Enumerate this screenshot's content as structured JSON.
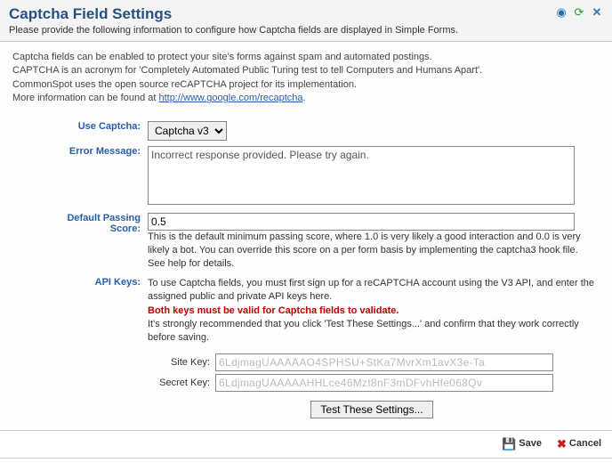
{
  "header": {
    "title": "Captcha Field Settings",
    "subtitle": "Please provide the following information to configure how Captcha fields are displayed in Simple Forms."
  },
  "intro": {
    "line1": "Captcha fields can be enabled to protect your site's forms against spam and automated postings.",
    "line2": "CAPTCHA is an acronym for 'Completely Automated Public Turing test to tell Computers and Humans Apart'.",
    "line3": "CommonSpot uses the open source reCAPTCHA project for its implementation.",
    "line4_prefix": "More information can be found at ",
    "link": "http://www.google.com/recaptcha",
    "line4_suffix": "."
  },
  "labels": {
    "use_captcha": "Use Captcha:",
    "error_message": "Error Message:",
    "default_passing_score_l1": "Default Passing",
    "default_passing_score_l2": "Score:",
    "api_keys": "API Keys:",
    "site_key": "Site Key:",
    "secret_key": "Secret Key:"
  },
  "values": {
    "use_captcha_selected": "Captcha v3",
    "error_message": "Incorrect response provided. Please try again.",
    "passing_score": "0.5",
    "site_key": "6LdjmagUAAAAAO4SPHSU+StKa7MvrXm1avX3e-Ta",
    "secret_key": "6LdjmagUAAAAAHHLce46Mzt8nF3mDFvhHfe068Qv"
  },
  "help": {
    "score": "This is the default minimum passing score, where 1.0 is very likely a good interaction and 0.0 is very likely a bot. You can override this score on a per form basis by implementing the captcha3 hook file. See help for details.",
    "api1": "To use Captcha fields, you must first sign up for a reCAPTCHA account using the V3 API, and enter the assigned public and private API keys here.",
    "api_warn": "Both keys must be valid for Captcha fields to validate.",
    "api2": "It's strongly recommended that you click 'Test These Settings...' and confirm that they work correctly before saving."
  },
  "buttons": {
    "test": "Test These Settings...",
    "save": "Save",
    "cancel": "Cancel"
  }
}
